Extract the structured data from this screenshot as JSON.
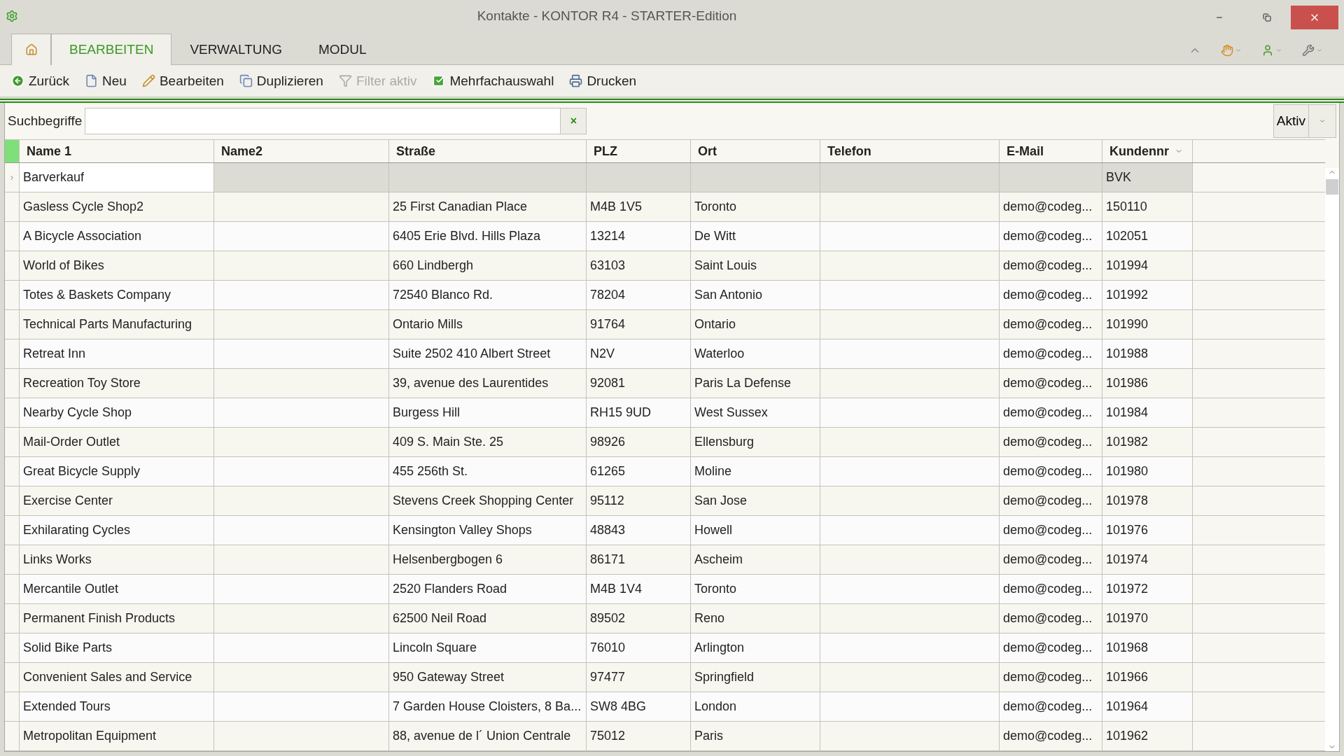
{
  "window": {
    "title": "Kontakte - KONTOR R4 - STARTER-Edition"
  },
  "tabs": [
    {
      "label": "BEARBEITEN",
      "selected": true
    },
    {
      "label": "VERWALTUNG",
      "selected": false
    },
    {
      "label": "MODUL",
      "selected": false
    }
  ],
  "toolbar": [
    {
      "label": "Zurück",
      "disabled": false
    },
    {
      "label": "Neu",
      "disabled": false
    },
    {
      "label": "Bearbeiten",
      "disabled": false
    },
    {
      "label": "Duplizieren",
      "disabled": false
    },
    {
      "label": "Filter aktiv",
      "disabled": true
    },
    {
      "label": "Mehrfachauswahl",
      "disabled": false
    },
    {
      "label": "Drucken",
      "disabled": false
    }
  ],
  "search": {
    "label": "Suchbegriffe",
    "clear": "×",
    "status": "Aktiv"
  },
  "table": {
    "columns": [
      {
        "label": "Name 1",
        "sorted": false
      },
      {
        "label": "Name2",
        "sorted": false
      },
      {
        "label": "Straße",
        "sorted": false
      },
      {
        "label": "PLZ",
        "sorted": false
      },
      {
        "label": "Ort",
        "sorted": false
      },
      {
        "label": "Telefon",
        "sorted": false
      },
      {
        "label": "E-Mail",
        "sorted": false
      },
      {
        "label": "Kundennr",
        "sorted": true
      }
    ],
    "rows": [
      {
        "selected": true,
        "cells": [
          "Barverkauf",
          "",
          "",
          "",
          "",
          "",
          "",
          "BVK"
        ]
      },
      {
        "selected": false,
        "cells": [
          "Gasless Cycle Shop2",
          "",
          "25 First Canadian Place",
          "M4B 1V5",
          "Toronto",
          "",
          "demo@codeg...",
          "150110"
        ]
      },
      {
        "selected": false,
        "cells": [
          "A Bicycle Association",
          "",
          "6405 Erie Blvd. Hills Plaza",
          "13214",
          "De Witt",
          "",
          "demo@codeg...",
          "102051"
        ]
      },
      {
        "selected": false,
        "cells": [
          "World of Bikes",
          "",
          "660 Lindbergh",
          "63103",
          "Saint Louis",
          "",
          "demo@codeg...",
          "101994"
        ]
      },
      {
        "selected": false,
        "cells": [
          "Totes & Baskets Company",
          "",
          "72540 Blanco Rd.",
          "78204",
          "San Antonio",
          "",
          "demo@codeg...",
          "101992"
        ]
      },
      {
        "selected": false,
        "cells": [
          "Technical Parts Manufacturing",
          "",
          "Ontario Mills",
          "91764",
          "Ontario",
          "",
          "demo@codeg...",
          "101990"
        ]
      },
      {
        "selected": false,
        "cells": [
          "Retreat Inn",
          "",
          "Suite 2502 410 Albert Street",
          "N2V",
          "Waterloo",
          "",
          "demo@codeg...",
          "101988"
        ]
      },
      {
        "selected": false,
        "cells": [
          "Recreation Toy Store",
          "",
          "39, avenue des Laurentides",
          "92081",
          "Paris La Defense",
          "",
          "demo@codeg...",
          "101986"
        ]
      },
      {
        "selected": false,
        "cells": [
          "Nearby Cycle Shop",
          "",
          "Burgess Hill",
          "RH15 9UD",
          "West Sussex",
          "",
          "demo@codeg...",
          "101984"
        ]
      },
      {
        "selected": false,
        "cells": [
          "Mail-Order Outlet",
          "",
          "409 S. Main Ste. 25",
          "98926",
          "Ellensburg",
          "",
          "demo@codeg...",
          "101982"
        ]
      },
      {
        "selected": false,
        "cells": [
          "Great Bicycle Supply",
          "",
          "455 256th St.",
          "61265",
          "Moline",
          "",
          "demo@codeg...",
          "101980"
        ]
      },
      {
        "selected": false,
        "cells": [
          "Exercise Center",
          "",
          "Stevens Creek Shopping Center",
          "95112",
          "San Jose",
          "",
          "demo@codeg...",
          "101978"
        ]
      },
      {
        "selected": false,
        "cells": [
          "Exhilarating Cycles",
          "",
          "Kensington Valley Shops",
          "48843",
          "Howell",
          "",
          "demo@codeg...",
          "101976"
        ]
      },
      {
        "selected": false,
        "cells": [
          "Links Works",
          "",
          "Helsenbergbogen 6",
          "86171",
          "Ascheim",
          "",
          "demo@codeg...",
          "101974"
        ]
      },
      {
        "selected": false,
        "cells": [
          "Mercantile Outlet",
          "",
          "2520 Flanders Road",
          "M4B 1V4",
          "Toronto",
          "",
          "demo@codeg...",
          "101972"
        ]
      },
      {
        "selected": false,
        "cells": [
          "Permanent Finish Products",
          "",
          "62500 Neil Road",
          "89502",
          "Reno",
          "",
          "demo@codeg...",
          "101970"
        ]
      },
      {
        "selected": false,
        "cells": [
          "Solid Bike Parts",
          "",
          "Lincoln Square",
          "76010",
          "Arlington",
          "",
          "demo@codeg...",
          "101968"
        ]
      },
      {
        "selected": false,
        "cells": [
          "Convenient Sales and Service",
          "",
          "950 Gateway Street",
          "97477",
          "Springfield",
          "",
          "demo@codeg...",
          "101966"
        ]
      },
      {
        "selected": false,
        "cells": [
          "Extended Tours",
          "",
          "7 Garden House Cloisters, 8 Ba...",
          "SW8 4BG",
          "London",
          "",
          "demo@codeg...",
          "101964"
        ]
      },
      {
        "selected": false,
        "cells": [
          "Metropolitan Equipment",
          "",
          "88, avenue de l´ Union Centrale",
          "75012",
          "Paris",
          "",
          "demo@codeg...",
          "101962"
        ]
      }
    ]
  }
}
